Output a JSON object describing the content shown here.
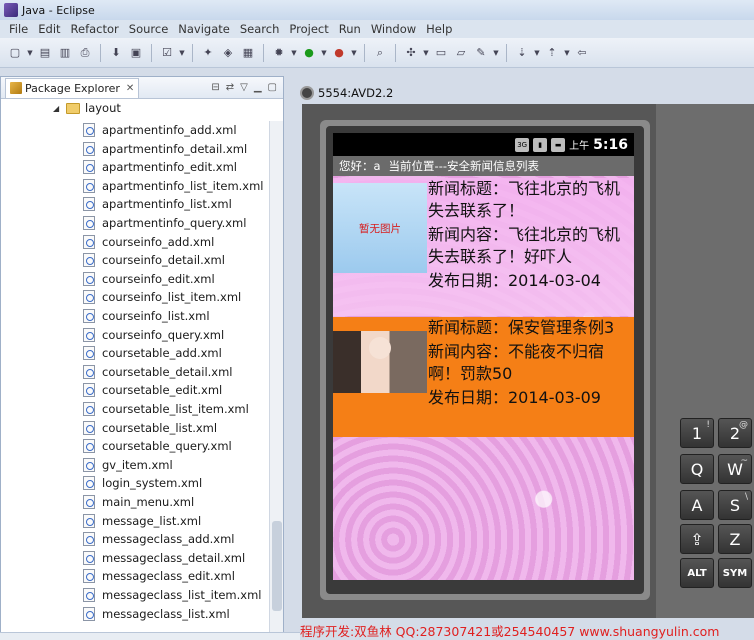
{
  "window": {
    "title": "Java - Eclipse"
  },
  "menu": [
    "File",
    "Edit",
    "Refactor",
    "Source",
    "Navigate",
    "Search",
    "Project",
    "Run",
    "Window",
    "Help"
  ],
  "explorer": {
    "tab_label": "Package Explorer",
    "folder": "layout",
    "files": [
      "apartmentinfo_add.xml",
      "apartmentinfo_detail.xml",
      "apartmentinfo_edit.xml",
      "apartmentinfo_list_item.xml",
      "apartmentinfo_list.xml",
      "apartmentinfo_query.xml",
      "courseinfo_add.xml",
      "courseinfo_detail.xml",
      "courseinfo_edit.xml",
      "courseinfo_list_item.xml",
      "courseinfo_list.xml",
      "courseinfo_query.xml",
      "coursetable_add.xml",
      "coursetable_detail.xml",
      "coursetable_edit.xml",
      "coursetable_list_item.xml",
      "coursetable_list.xml",
      "coursetable_query.xml",
      "gv_item.xml",
      "login_system.xml",
      "main_menu.xml",
      "message_list.xml",
      "messageclass_add.xml",
      "messageclass_detail.xml",
      "messageclass_edit.xml",
      "messageclass_list_item.xml",
      "messageclass_list.xml"
    ]
  },
  "emulator": {
    "tab_label": "5554:AVD2.2",
    "status": {
      "network": "3G",
      "ampm": "上午",
      "time": "5:16"
    },
    "info_user": "您好：a",
    "info_location": "当前位置---安全新闻信息列表",
    "news": [
      {
        "thumb_text": "暂无图片",
        "title": "新闻标题：飞往北京的飞机失去联系了！",
        "content": "新闻内容：飞往北京的飞机失去联系了！好吓人",
        "date": "发布日期：2014-03-04"
      },
      {
        "thumb_text": "",
        "title": "新闻标题：保安管理条例3",
        "content": "新闻内容：不能夜不归宿啊！罚款50",
        "date": "发布日期：2014-03-09"
      }
    ],
    "keys": [
      {
        "main": "1",
        "alt": "!"
      },
      {
        "main": "2",
        "alt": "@"
      },
      {
        "main": "Q",
        "alt": ""
      },
      {
        "main": "W",
        "alt": "~"
      },
      {
        "main": "A",
        "alt": ""
      },
      {
        "main": "S",
        "alt": "\\"
      },
      {
        "main": "⇪",
        "alt": ""
      },
      {
        "main": "Z",
        "alt": ""
      },
      {
        "main": "ALT",
        "alt": ""
      },
      {
        "main": "SYM",
        "alt": ""
      }
    ]
  },
  "footer": {
    "text": "程序开发:双鱼林 QQ:287307421或254540457 www.shuangyulin.com"
  },
  "colors": {
    "accent_orange": "#f57f16",
    "screen_pink": "#e7a6e2",
    "watermark_red": "#e02020"
  }
}
